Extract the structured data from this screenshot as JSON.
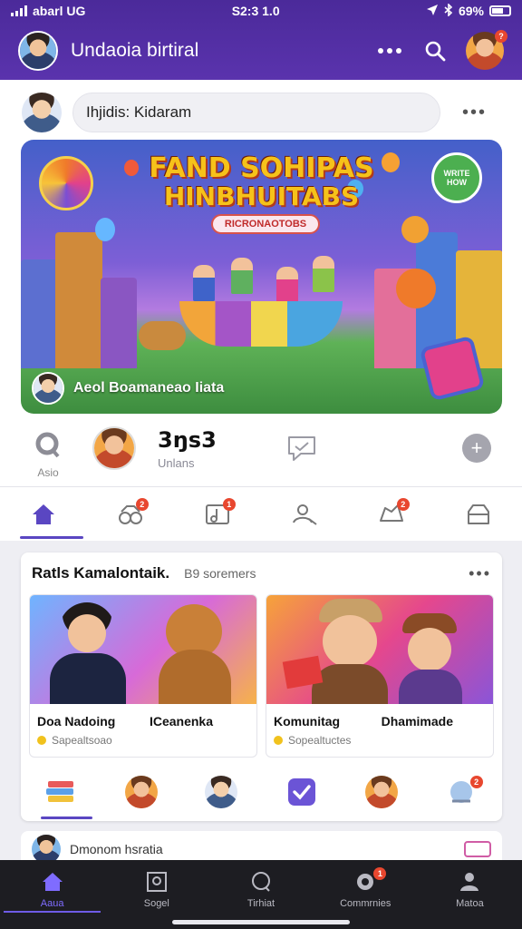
{
  "status_bar": {
    "carrier": "abarl UG",
    "time": "S2:3 1.0",
    "battery": "69%"
  },
  "header": {
    "title": "Undaoia birtiral",
    "more_icon": "more-horizontal-icon",
    "search_icon": "search-icon",
    "profile_badge": "?"
  },
  "composer": {
    "placeholder": "Ihjidis: Kidaram"
  },
  "banner": {
    "title_line1": "FAND SOHIPAS",
    "title_line2": "HINBHUITABS",
    "ribbon": "RICRONAOTOBS",
    "seal": "WRITE HOW",
    "caption": "Aeol Boamaneao Iiata"
  },
  "stats": {
    "lens_label": "Asio",
    "number": "3ŋs3",
    "sub": "Unlans"
  },
  "tabs": [
    {
      "icon": "home-icon",
      "badge": ""
    },
    {
      "icon": "people-icon",
      "badge": "2"
    },
    {
      "icon": "music-icon",
      "badge": "1"
    },
    {
      "icon": "user-search-icon",
      "badge": ""
    },
    {
      "icon": "notification-icon",
      "badge": "2"
    },
    {
      "icon": "store-icon",
      "badge": ""
    }
  ],
  "feed": {
    "title": "Ratls Kamalontaik.",
    "subtitle": "B9 soremers",
    "tiles": [
      {
        "label_left": "Doa Nadoing",
        "label_right": "ICeanenka",
        "meta": "Sapealtsoao"
      },
      {
        "label_left": "Komunitag",
        "label_right": "Dhamimade",
        "meta": "Sopealtuctes"
      }
    ],
    "icon_row": [
      {
        "icon": "stack-icon",
        "badge": ""
      },
      {
        "icon": "avatar-icon",
        "badge": ""
      },
      {
        "icon": "avatar-icon",
        "badge": ""
      },
      {
        "icon": "checkmark-icon",
        "badge": ""
      },
      {
        "icon": "avatar-icon",
        "badge": ""
      },
      {
        "icon": "globe-icon",
        "badge": "2"
      }
    ]
  },
  "peek": {
    "text": "Dmonom hsratia"
  },
  "bottom_nav": [
    {
      "icon": "home-icon",
      "label": "Aaua",
      "active": true,
      "badge": ""
    },
    {
      "icon": "image-icon",
      "label": "Sogel",
      "active": false,
      "badge": ""
    },
    {
      "icon": "chat-icon",
      "label": "Tirhiat",
      "active": false,
      "badge": ""
    },
    {
      "icon": "community-icon",
      "label": "Commrnies",
      "active": false,
      "badge": "1"
    },
    {
      "icon": "person-icon",
      "label": "Matoa",
      "active": false,
      "badge": ""
    }
  ],
  "colors": {
    "header": "#4b2a9a",
    "accent": "#5a46c2",
    "badge": "#e8472f",
    "nav_bg": "#1d1d22"
  }
}
